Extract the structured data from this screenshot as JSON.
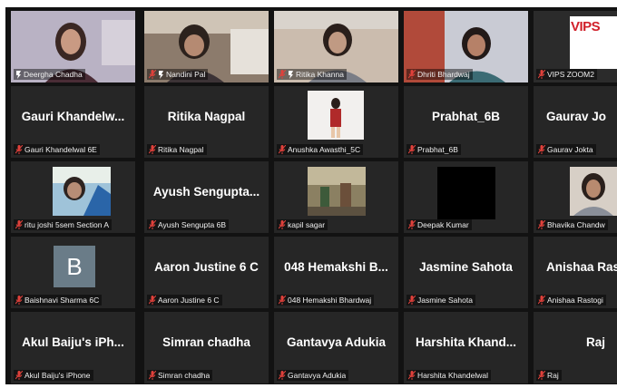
{
  "colors": {
    "grid_background": "#121212",
    "tile_background": "#262626",
    "active_speaker_border": "#c9e04a",
    "muted_mic": "#e0413b"
  },
  "participants": [
    {
      "big_name": "",
      "label": "Deergha Chadha",
      "video": "webcam",
      "cohost": true,
      "muted": false,
      "active": true
    },
    {
      "big_name": "",
      "label": "Nandini Pal",
      "video": "webcam",
      "cohost": true,
      "muted": true
    },
    {
      "big_name": "",
      "label": "Ritika Khanna",
      "video": "webcam",
      "cohost": true,
      "muted": true
    },
    {
      "big_name": "",
      "label": "Dhriti Bhardwaj",
      "video": "webcam",
      "cohost": false,
      "muted": true
    },
    {
      "big_name": "",
      "label": "VIPS ZOOM2",
      "video": "logo",
      "logo_text": "VIPS",
      "cohost": false,
      "muted": true
    },
    {
      "big_name": "Gauri Khandelw...",
      "label": "Gauri Khandelwal 6E",
      "video": "none",
      "muted": true
    },
    {
      "big_name": "Ritika Nagpal",
      "label": "Ritika Nagpal",
      "video": "none",
      "muted": true
    },
    {
      "big_name": "",
      "label": "Anushka Awasthi_5C",
      "video": "profile-photo",
      "muted": true
    },
    {
      "big_name": "Prabhat_6B",
      "label": "Prabhat_6B",
      "video": "none",
      "muted": true
    },
    {
      "big_name": "Gaurav Jo",
      "label": "Gaurav Jokta",
      "video": "none",
      "muted": true
    },
    {
      "big_name": "",
      "label": "ritu joshi 5sem Section A",
      "video": "profile-photo",
      "muted": true
    },
    {
      "big_name": "Ayush Sengupta...",
      "label": "Ayush Sengupta 6B",
      "video": "none",
      "muted": true
    },
    {
      "big_name": "",
      "label": "kapil sagar",
      "video": "profile-photo",
      "muted": true
    },
    {
      "big_name": "",
      "label": "Deepak Kumar",
      "video": "black-photo",
      "muted": true
    },
    {
      "big_name": "",
      "label": "Bhavika Chandw",
      "video": "profile-photo",
      "muted": true
    },
    {
      "big_name": "",
      "label": "Baishnavi Sharma 6C",
      "video": "initial",
      "initial": "B",
      "muted": true
    },
    {
      "big_name": "Aaron Justine 6 C",
      "label": "Aaron Justine 6 C",
      "video": "none",
      "muted": true
    },
    {
      "big_name": "048 Hemakshi B...",
      "label": "048 Hemakshi Bhardwaj",
      "video": "none",
      "muted": true
    },
    {
      "big_name": "Jasmine Sahota",
      "label": "Jasmine Sahota",
      "video": "none",
      "muted": true
    },
    {
      "big_name": "Anishaa Ras",
      "label": "Anishaa Rastogi",
      "video": "none",
      "muted": true
    },
    {
      "big_name": "Akul Baiju's iPh...",
      "label": "Akul Baiju's iPhone",
      "video": "none",
      "muted": true
    },
    {
      "big_name": "Simran chadha",
      "label": "Simran chadha",
      "video": "none",
      "muted": true
    },
    {
      "big_name": "Gantavya Adukia",
      "label": "Gantavya Adukia",
      "video": "none",
      "muted": true
    },
    {
      "big_name": "Harshita Khand...",
      "label": "Harshita Khandelwal",
      "video": "none",
      "muted": true
    },
    {
      "big_name": "Raj",
      "label": "Raj",
      "video": "none",
      "muted": true
    }
  ]
}
